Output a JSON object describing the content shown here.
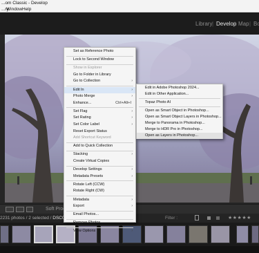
{
  "window": {
    "title": "...om Classic - Develop"
  },
  "menubar": {
    "items": [
      "...ry",
      "Window",
      "Help"
    ]
  },
  "modules": {
    "library": "Library",
    "develop": "Develop",
    "map": "Map",
    "next": "Bo",
    "sep": "|"
  },
  "toolbar": {
    "soft_proof": "Soft Proof"
  },
  "infobar": {
    "count": "2231 photos / 2 selected /",
    "filename": "DSC01385.ARW",
    "filter": "Filter :",
    "stars": "★★★★★"
  },
  "context_menu": {
    "items": [
      {
        "label": "Set as Reference Photo"
      },
      {
        "sep": true
      },
      {
        "label": "Lock to Second Window"
      },
      {
        "sep": true
      },
      {
        "label": "Show in Explorer",
        "disabled": true
      },
      {
        "label": "Go to Folder in Library"
      },
      {
        "label": "Go to Collection",
        "arrow": true
      },
      {
        "sep": true
      },
      {
        "label": "Edit In",
        "arrow": true,
        "highlight": true
      },
      {
        "label": "Photo Merge",
        "arrow": true
      },
      {
        "label": "Enhance...",
        "shortcut": "Ctrl+Alt+I"
      },
      {
        "sep": true
      },
      {
        "label": "Set Flag",
        "arrow": true
      },
      {
        "label": "Set Rating",
        "arrow": true
      },
      {
        "label": "Set Color Label",
        "arrow": true
      },
      {
        "label": "Reset Export Status"
      },
      {
        "label": "Add Shortcut Keyword",
        "disabled": true
      },
      {
        "sep": true
      },
      {
        "label": "Add to Quick Collection"
      },
      {
        "sep": true
      },
      {
        "label": "Stacking",
        "arrow": true
      },
      {
        "label": "Create Virtual Copies"
      },
      {
        "sep": true
      },
      {
        "label": "Develop Settings",
        "arrow": true
      },
      {
        "label": "Metadata Presets",
        "arrow": true
      },
      {
        "sep": true
      },
      {
        "label": "Rotate Left (CCW)"
      },
      {
        "label": "Rotate Right (CW)"
      },
      {
        "sep": true
      },
      {
        "label": "Metadata",
        "arrow": true
      },
      {
        "label": "Export",
        "arrow": true
      },
      {
        "sep": true
      },
      {
        "label": "Email Photos..."
      },
      {
        "sep": true
      },
      {
        "label": "Remove Photos..."
      },
      {
        "sep": true
      },
      {
        "label": "View Options",
        "arrow": true
      }
    ]
  },
  "submenu": {
    "items": [
      {
        "label": "Edit in Adobe Photoshop 2024..."
      },
      {
        "label": "Edit in Other Application..."
      },
      {
        "sep": true
      },
      {
        "label": "Topaz Photo AI"
      },
      {
        "sep": true
      },
      {
        "label": "Open as Smart Object in Photoshop..."
      },
      {
        "label": "Open as Smart Object Layers in Photoshop..."
      },
      {
        "label": "Merge to Panorama in Photoshop..."
      },
      {
        "label": "Merge to HDR Pro in Photoshop..."
      },
      {
        "label": "Open as Layers in Photoshop...",
        "highlight": true
      }
    ]
  },
  "colors": {
    "accent": "#e6e6e6",
    "menu_bg": "#f5f5f5",
    "menu_highlight": "#d9e6f6"
  },
  "icons": {
    "submenu": "chevron-right-icon",
    "rating": "star-icon"
  }
}
